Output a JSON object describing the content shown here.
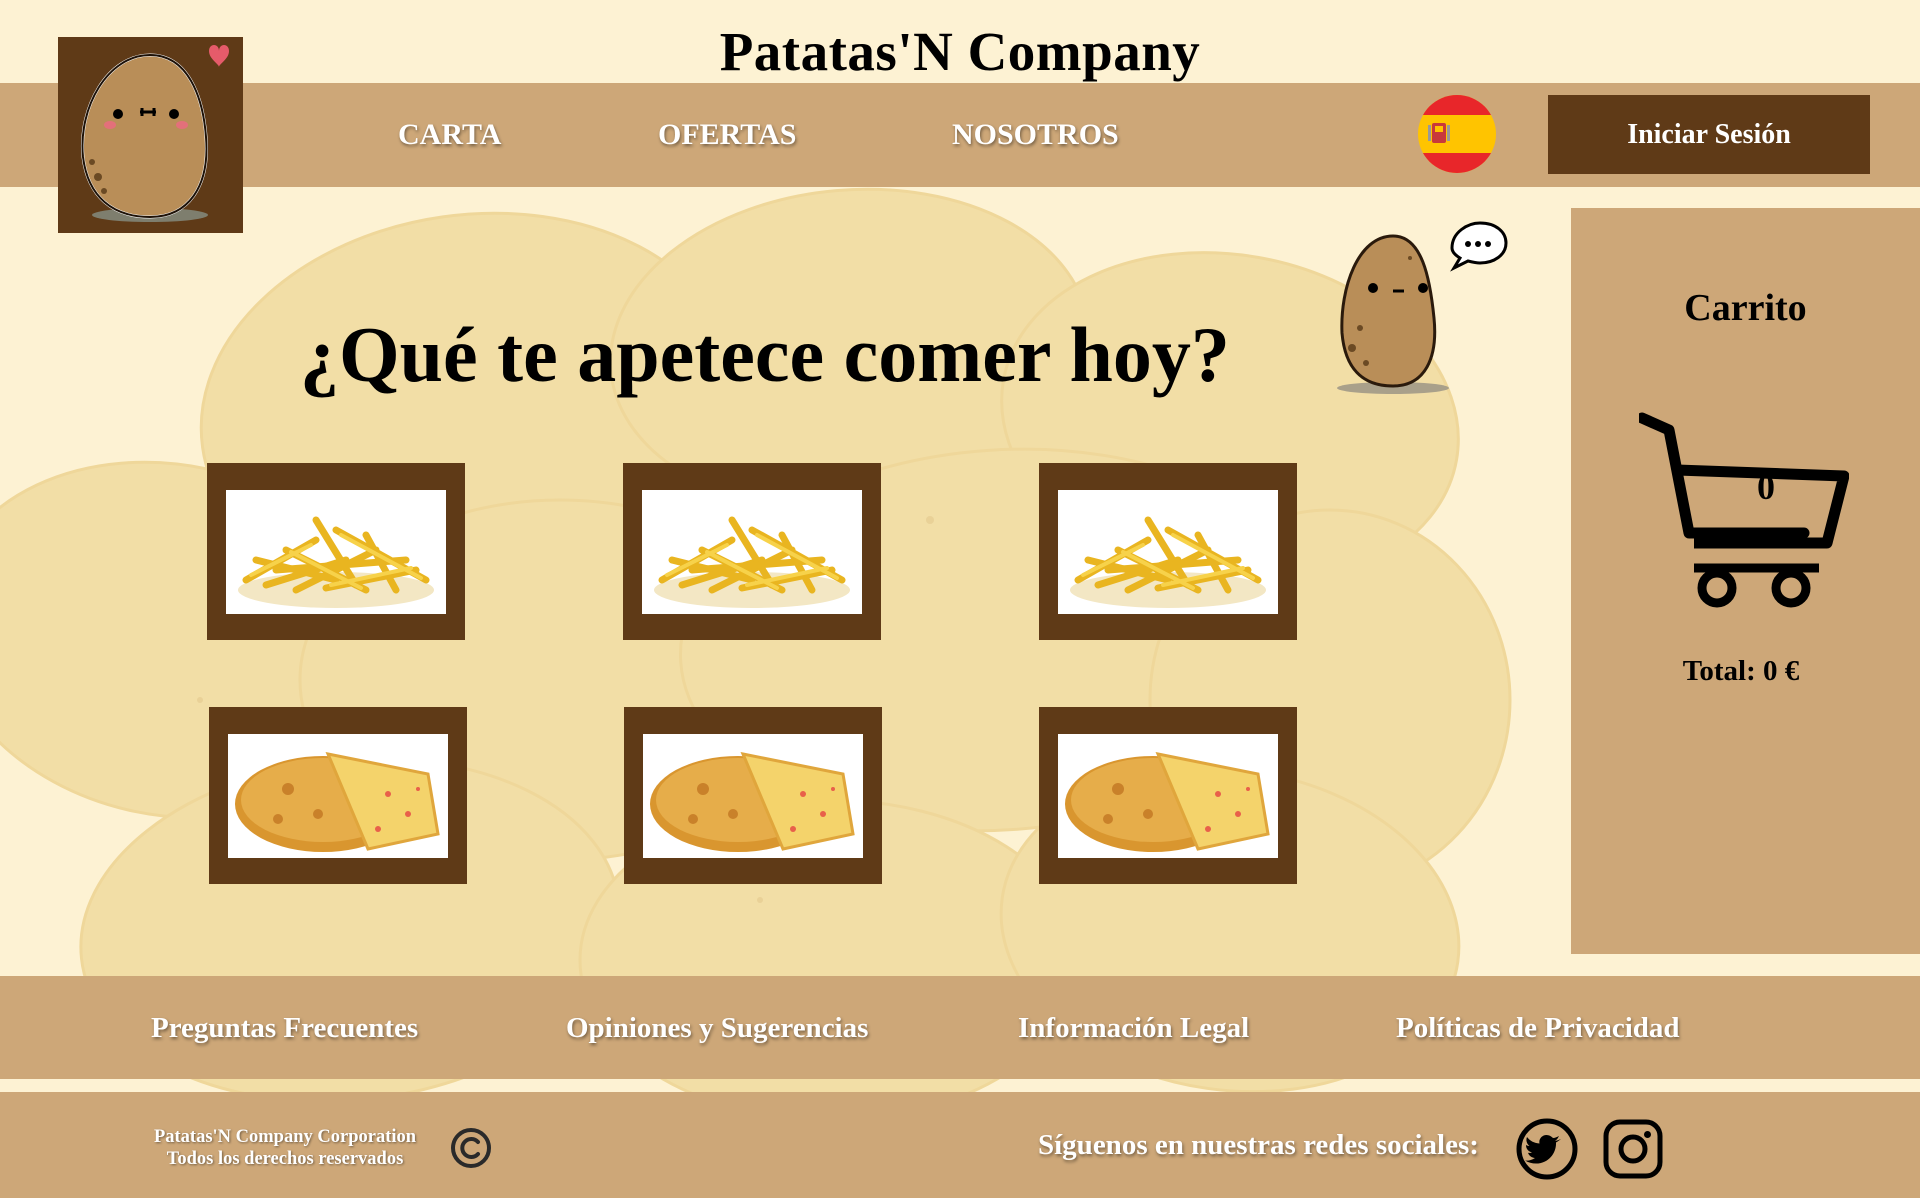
{
  "header": {
    "site_title": "Patatas'N Company",
    "nav": [
      {
        "label": "CARTA"
      },
      {
        "label": "OFERTAS"
      },
      {
        "label": "NOSOTROS"
      }
    ],
    "language_icon": "spain-flag-icon",
    "login_label": "Iniciar Sesión",
    "logo_icon": "potato-mascot-logo"
  },
  "main": {
    "heading": "¿Qué te apetece comer hoy?",
    "mascot_icon": "thinking-potato-icon",
    "products": [
      {
        "image": "french-fries"
      },
      {
        "image": "french-fries"
      },
      {
        "image": "french-fries"
      },
      {
        "image": "spanish-omelette"
      },
      {
        "image": "spanish-omelette"
      },
      {
        "image": "spanish-omelette"
      }
    ]
  },
  "cart": {
    "title": "Carrito",
    "count": "0",
    "total": "Total: 0 €",
    "icon": "shopping-cart-icon"
  },
  "footer": {
    "links": [
      {
        "label": "Preguntas Frecuentes"
      },
      {
        "label": "Opiniones y Sugerencias"
      },
      {
        "label": "Información Legal"
      },
      {
        "label": "Políticas de Privacidad"
      }
    ],
    "copyright_line1": "Patatas'N Company Corporation",
    "copyright_line2": "Todos los derechos reservados",
    "social_text": "Síguenos en nuestras redes sociales:",
    "social_icons": [
      "twitter-icon",
      "instagram-icon"
    ]
  },
  "colors": {
    "background": "#fdf2d3",
    "bar": "#cda778",
    "dark_brown": "#5f3a17",
    "white": "#ffffff"
  }
}
